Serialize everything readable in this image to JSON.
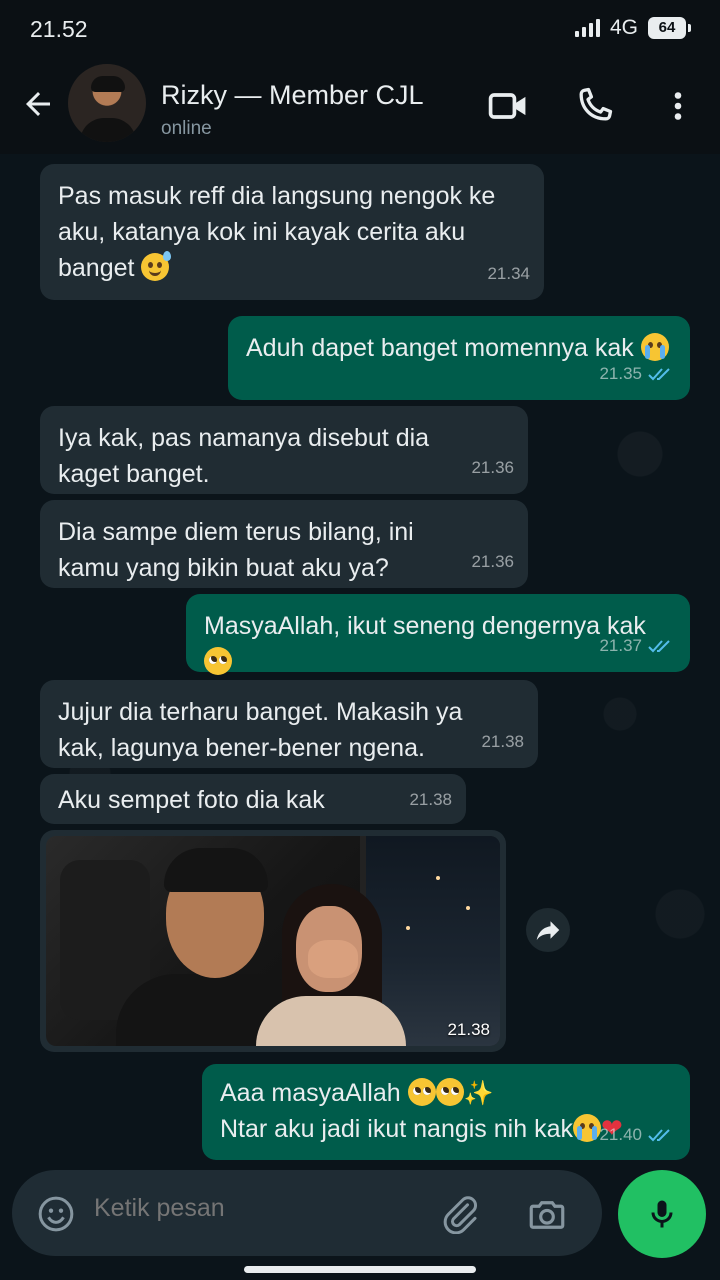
{
  "status_bar": {
    "time": "21.52",
    "network": "4G",
    "battery": "64"
  },
  "header": {
    "contact_name": "Rizky — Member CJL",
    "status": "online"
  },
  "messages": [
    {
      "direction": "in",
      "text": "Pas masuk reff dia langsung nengok ke aku, katanya kok ini kayak cerita aku banget",
      "emoji": [
        "sweat-smile"
      ],
      "time": "21.34"
    },
    {
      "direction": "out",
      "text": "Aduh dapet banget momennya kak",
      "emoji": [
        "loudly-crying"
      ],
      "time": "21.35",
      "read": true
    },
    {
      "direction": "in",
      "text": "Iya kak, pas namanya disebut dia kaget banget.",
      "time": "21.36"
    },
    {
      "direction": "in",
      "text": "Dia sampe diem terus bilang, ini kamu yang bikin buat aku ya?",
      "time": "21.36"
    },
    {
      "direction": "out",
      "text": "MasyaAllah, ikut seneng dengernya kak",
      "emoji": [
        "pleading-face"
      ],
      "time": "21.37",
      "read": true
    },
    {
      "direction": "in",
      "text": "Jujur dia terharu banget. Makasih ya kak, lagunya bener-bener ngena.",
      "time": "21.38"
    },
    {
      "direction": "in",
      "text": "Aku sempet foto dia kak",
      "time": "21.38"
    },
    {
      "direction": "in",
      "type": "image",
      "time": "21.38"
    },
    {
      "direction": "out",
      "line1": "Aaa masyaAllah",
      "line2": "Ntar aku jadi ikut nangis nih kak",
      "emoji": [
        "pleading-face",
        "pleading-face",
        "sparkles",
        "loudly-crying",
        "red-heart"
      ],
      "time": "21.40",
      "read": true
    }
  ],
  "composer": {
    "placeholder": "Ketik pesan"
  },
  "colors": {
    "incoming": "#202c33",
    "outgoing": "#005c4b",
    "read_ticks": "#53bdeb",
    "mic": "#21c063"
  },
  "icons": [
    "back-arrow-icon",
    "video-call-icon",
    "phone-icon",
    "more-vert-icon",
    "emoji-icon",
    "attach-icon",
    "camera-icon",
    "mic-icon",
    "forward-icon",
    "read-ticks-icon"
  ]
}
